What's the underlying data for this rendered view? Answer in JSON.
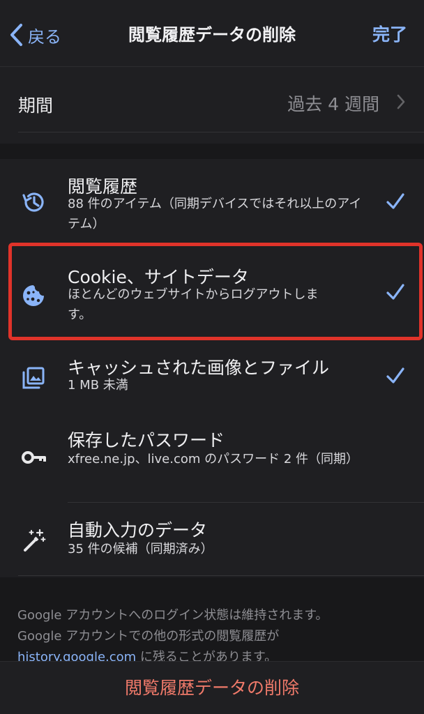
{
  "nav": {
    "back_label": "戻る",
    "title": "閲覧履歴データの削除",
    "done_label": "完了"
  },
  "period": {
    "label": "期間",
    "value": "過去 4 週間"
  },
  "items": [
    {
      "title": "閲覧履歴",
      "subtitle": "88 件のアイテム（同期デバイスではそれ以上のアイテム）",
      "icon": "history-icon",
      "checked": true
    },
    {
      "title": "Cookie、サイトデータ",
      "subtitle": "ほとんどのウェブサイトからログアウトします。",
      "icon": "cookie-icon",
      "checked": true
    },
    {
      "title": "キャッシュされた画像とファイル",
      "subtitle": "1 MB 未満",
      "icon": "image-stack-icon",
      "checked": true
    },
    {
      "title": "保存したパスワード",
      "subtitle": "xfree.ne.jp、live.com のパスワード 2 件（同期）",
      "icon": "key-icon",
      "checked": false
    },
    {
      "title": "自動入力のデータ",
      "subtitle": "35 件の候補（同期済み）",
      "icon": "magic-wand-icon",
      "checked": false
    }
  ],
  "footer": {
    "line1": "Google アカウントへのログイン状態は維持されます。",
    "line2": "Google アカウントでの他の形式の閲覧履歴が",
    "link": "history.google.com",
    "line3_suffix": " に残ることがあります。"
  },
  "bottom": {
    "delete_label": "閲覧履歴データの削除"
  },
  "colors": {
    "accent": "#8ab4f8",
    "destructive": "#f07a6a",
    "highlight": "#e0332a",
    "background": "#18181a",
    "cell": "#1f1f22"
  }
}
